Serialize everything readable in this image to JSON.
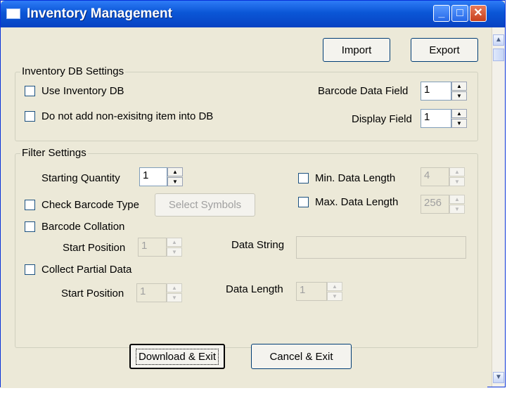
{
  "window": {
    "title": "Inventory Management"
  },
  "titlebar_buttons": {
    "minimize": "_",
    "maximize": "□",
    "close": "✕"
  },
  "toolbar": {
    "import_label": "Import",
    "export_label": "Export"
  },
  "inventory_db": {
    "group_title": "Inventory DB Settings",
    "use_inventory_db": {
      "label": "Use Inventory DB",
      "checked": false
    },
    "no_add_nonexisting": {
      "label": "Do not add non-exisitng item into DB",
      "checked": false
    },
    "barcode_data_field": {
      "label": "Barcode Data Field",
      "value": "1"
    },
    "display_field": {
      "label": "Display Field",
      "value": "1"
    }
  },
  "filter": {
    "group_title": "Filter Settings",
    "starting_quantity": {
      "label": "Starting Quantity",
      "value": "1"
    },
    "check_barcode_type": {
      "label": "Check Barcode Type",
      "checked": false
    },
    "select_symbols_label": "Select Symbols",
    "min_data_length": {
      "label": "Min. Data Length",
      "checked": false,
      "value": "4"
    },
    "max_data_length": {
      "label": "Max. Data Length",
      "checked": false,
      "value": "256"
    },
    "barcode_collation": {
      "label": "Barcode Collation",
      "checked": false
    },
    "collation_start_position": {
      "label": "Start Position",
      "value": "1"
    },
    "data_string": {
      "label": "Data String",
      "value": ""
    },
    "collect_partial_data": {
      "label": "Collect Partial Data",
      "checked": false
    },
    "partial_start_position": {
      "label": "Start Position",
      "value": "1"
    },
    "data_length": {
      "label": "Data Length",
      "value": "1"
    }
  },
  "footer": {
    "download_exit_label": "Download & Exit",
    "cancel_exit_label": "Cancel & Exit"
  },
  "colors": {
    "titlebar": "#0a56d6",
    "face": "#ece9d8",
    "close": "#c8401c"
  }
}
